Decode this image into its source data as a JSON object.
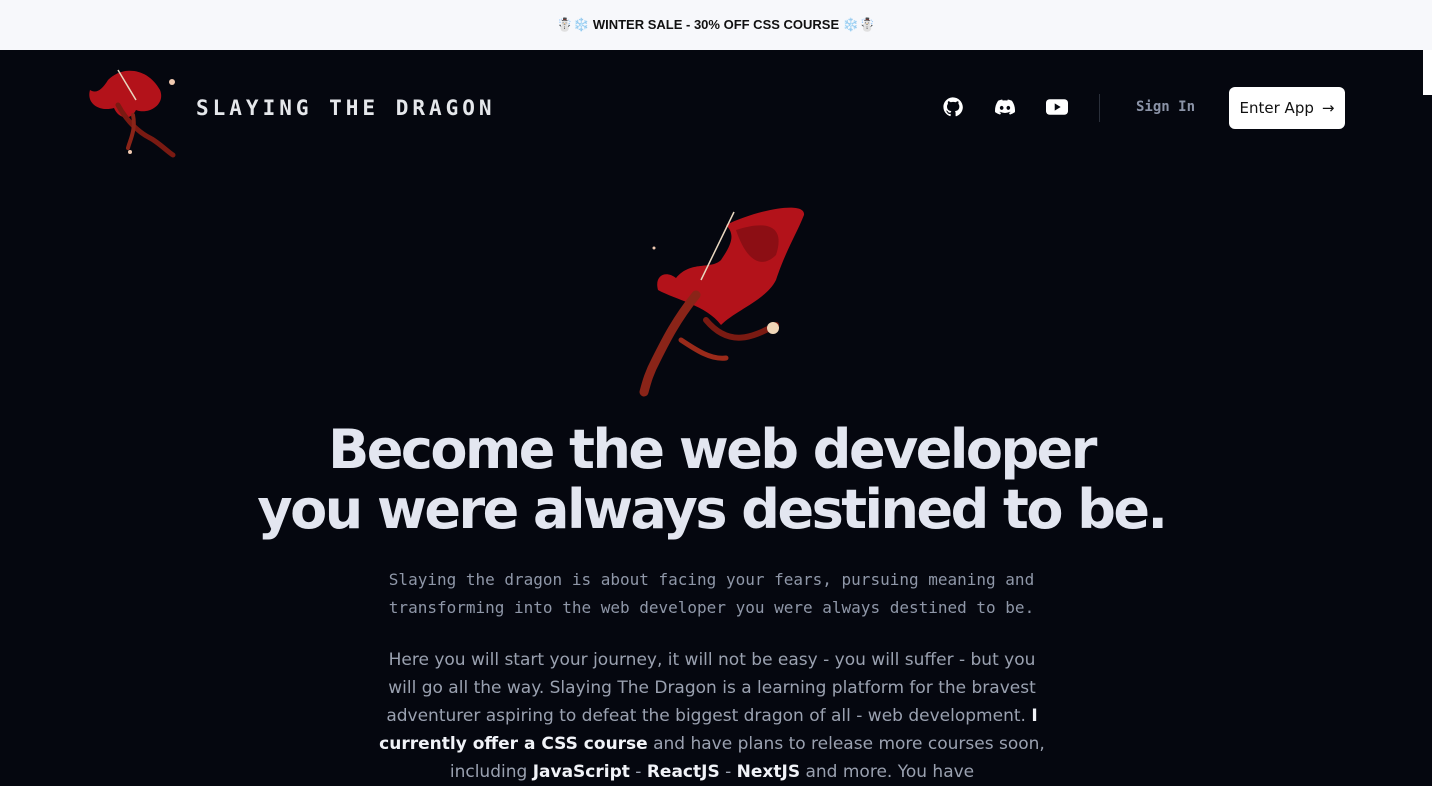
{
  "banner": {
    "text": "☃️❄️ WINTER SALE - 30% OFF CSS COURSE ❄️☃️"
  },
  "nav": {
    "title": "SLAYING THE DRAGON",
    "icons": [
      "github-icon",
      "discord-icon",
      "youtube-icon"
    ],
    "sign_in": "Sign In",
    "enter_app": "Enter App",
    "enter_arrow": "→"
  },
  "hero": {
    "headline_line1": "Become the web developer",
    "headline_line2": "you were always destined to be.",
    "subtitle": "Slaying the dragon is about facing your fears, pursuing meaning and transforming into the web developer you were always destined to be.",
    "body_part1": "Here you will start your journey, it will not be easy - you will suffer - but you will go all the way. Slaying The Dragon is a learning platform for the bravest adventurer aspiring to defeat the biggest dragon of all - web development.",
    "body_bold1": "I currently offer a CSS course",
    "body_part2": " and have plans to release more courses soon, including ",
    "body_bold_js": "JavaScript",
    "sep1": " - ",
    "body_bold_react": "ReactJS",
    "sep2": " - ",
    "body_bold_next": "NextJS",
    "body_part3": " and more. You have"
  },
  "colors": {
    "background": "#05070f",
    "banner": "#f7f8fb",
    "accent": "#c8161d",
    "text": "#e3e6f0",
    "muted": "#8f97a8"
  }
}
